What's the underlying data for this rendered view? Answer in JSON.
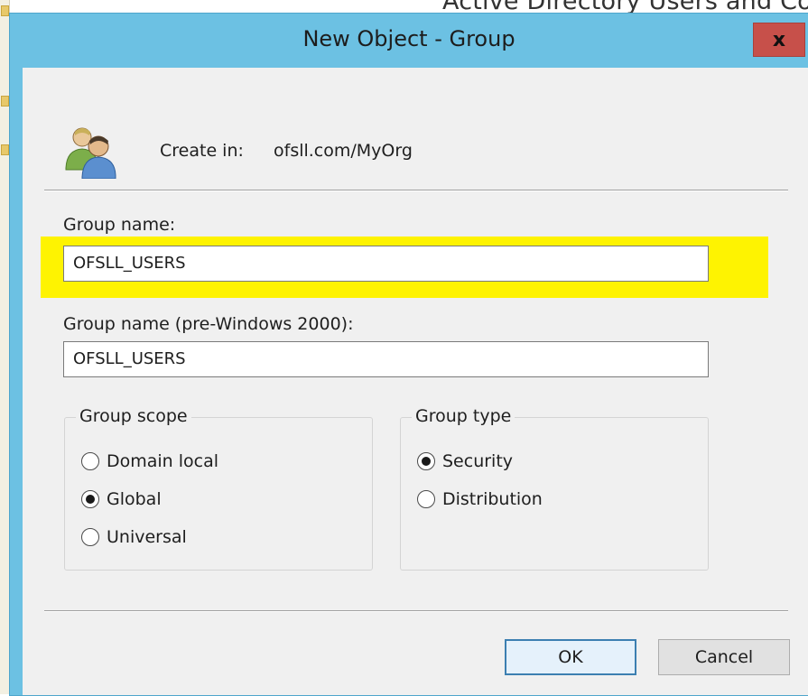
{
  "background_window": {
    "title": "Active Directory Users and Com"
  },
  "dialog": {
    "title": "New Object - Group",
    "close_label": "x"
  },
  "create_in": {
    "label": "Create in:",
    "value": "ofsll.com/MyOrg",
    "icon": "users-group-icon"
  },
  "group_name": {
    "label": "Group name:",
    "value": "OFSLL_USERS"
  },
  "group_name_pre2000": {
    "label": "Group name (pre-Windows 2000):",
    "value": "OFSLL_USERS"
  },
  "group_scope": {
    "legend": "Group scope",
    "options": [
      {
        "label": "Domain local",
        "checked": false
      },
      {
        "label": "Global",
        "checked": true
      },
      {
        "label": "Universal",
        "checked": false
      }
    ]
  },
  "group_type": {
    "legend": "Group type",
    "options": [
      {
        "label": "Security",
        "checked": true
      },
      {
        "label": "Distribution",
        "checked": false
      }
    ]
  },
  "buttons": {
    "ok": "OK",
    "cancel": "Cancel"
  },
  "colors": {
    "titlebar": "#6cc1e3",
    "close": "#c7504a",
    "highlight": "#fef301",
    "client": "#f0f0f0"
  }
}
